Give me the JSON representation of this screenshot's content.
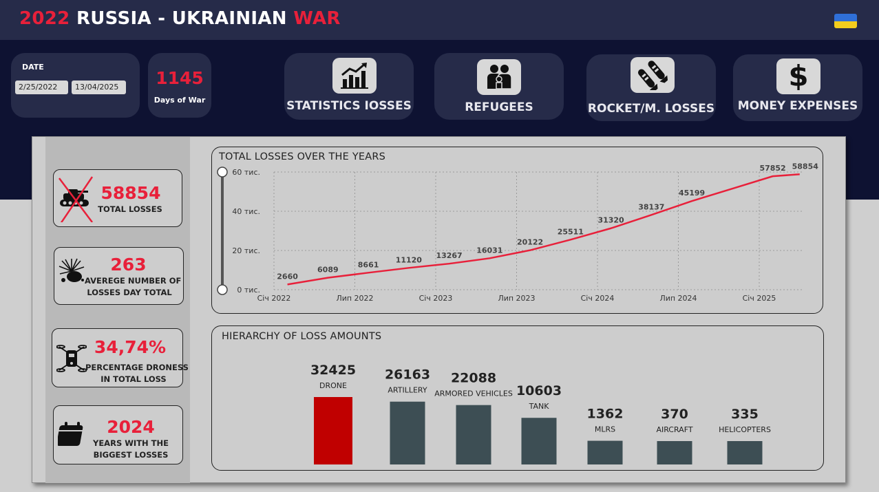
{
  "header": {
    "title_year": "2022",
    "title_mid": "RUSSIA - UKRAINIAN",
    "title_end": "WAR",
    "flag": "ukraine-flag-icon"
  },
  "date_filter": {
    "label": "DATE",
    "start": "2/25/2022",
    "end": "13/04/2025"
  },
  "days": {
    "value": "1145",
    "label": "Days of War"
  },
  "nav": [
    {
      "label": "STATISTICS IOSSES",
      "icon": "bar-chart-icon"
    },
    {
      "label": "REFUGEES",
      "icon": "people-icon"
    },
    {
      "label": "ROCKET/M. LOSSES",
      "icon": "rocket-icon"
    },
    {
      "label": "MONEY EXPENSES",
      "icon": "dollar-icon"
    }
  ],
  "kpis": [
    {
      "value": "58854",
      "label": "TOTAL LOSSES",
      "icon": "crossed-tank-icon"
    },
    {
      "value": "263",
      "label1": "AVEREGE NUMBER OF",
      "label2": "LOSSES DAY TOTAL",
      "icon": "explosion-icon"
    },
    {
      "value": "34,74%",
      "label1": "PERCENTAGE DRONESS",
      "label2": "IN TOTAL LOSS",
      "icon": "drone-icon"
    },
    {
      "value": "2024",
      "label1": "YEARS WITH THE",
      "label2": "BIGGEST LOSSES",
      "icon": "calendar-icon"
    }
  ],
  "colors": {
    "accent_red": "#e8203a",
    "navy": "#262b49",
    "dark_band": "#0e1232",
    "bar_dark": "#3d4e54",
    "bar_highlight": "#c00000"
  },
  "chart_data": [
    {
      "type": "line",
      "title": "TOTAL LOSSES OVER THE YEARS",
      "x": [
        "2022-02",
        "2022-05",
        "2022-08",
        "2022-11",
        "2023-02",
        "2023-05",
        "2023-08",
        "2023-11",
        "2024-02",
        "2024-05",
        "2024-08",
        "2024-11",
        "2025-02",
        "2025-04"
      ],
      "values": [
        2660,
        6089,
        8661,
        11120,
        13267,
        16031,
        20122,
        25511,
        31320,
        38137,
        45199,
        51500,
        57852,
        58854
      ],
      "labels": [
        "2660",
        "6089",
        "8661",
        "11120",
        "13267",
        "16031",
        "20122",
        "25511",
        "31320",
        "38137",
        "45199",
        "",
        "57852",
        "58854"
      ],
      "x_ticks": [
        "Січ 2022",
        "Лип 2022",
        "Січ 2023",
        "Лип 2023",
        "Січ 2024",
        "Лип 2024",
        "Січ 2025"
      ],
      "y_ticks": [
        "0 тис.",
        "20 тис.",
        "40 тис.",
        "60 тис."
      ],
      "ylim": [
        0,
        60000
      ],
      "grid": true,
      "line_color": "#e8203a"
    },
    {
      "type": "bar",
      "title": "HIERARCHY OF LOSS AMOUNTS",
      "categories": [
        "DRONE",
        "ARTILLERY",
        "ARMORED VEHICLES",
        "TANK",
        "MLRS",
        "AIRCRAFT",
        "HELICOPTERS"
      ],
      "values": [
        32425,
        26163,
        22088,
        10603,
        1362,
        370,
        335
      ],
      "highlight": "DRONE"
    }
  ]
}
